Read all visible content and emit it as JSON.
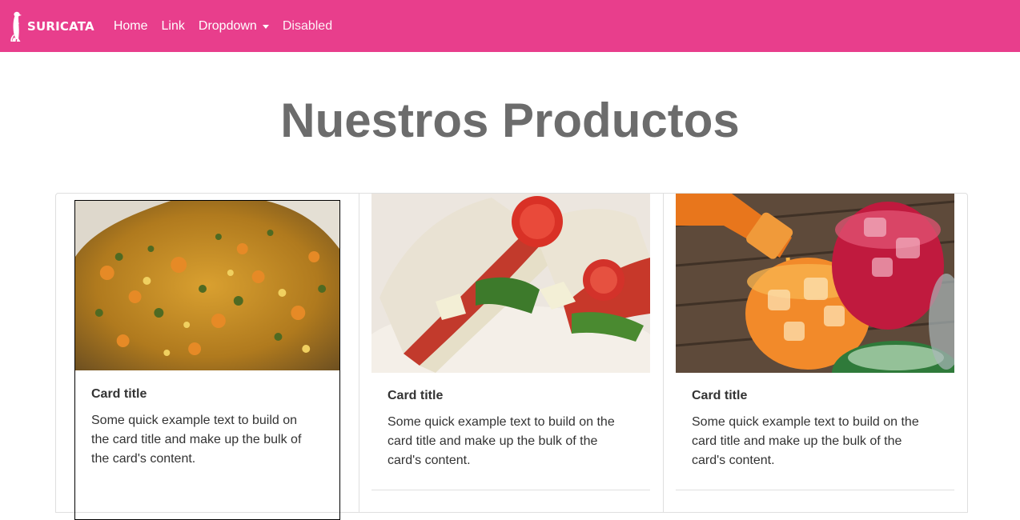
{
  "brand": {
    "name": "SURICATA",
    "icon": "meerkat-icon"
  },
  "nav": {
    "home": "Home",
    "link": "Link",
    "dropdown": "Dropdown",
    "disabled": "Disabled"
  },
  "page": {
    "title": "Nuestros Productos"
  },
  "cards": [
    {
      "image": "vegetable-dish-image",
      "title": "Card title",
      "text": "Some quick example text to build on the card title and make up the bulk of the card's content."
    },
    {
      "image": "sandwich-image",
      "title": "Card title",
      "text": "Some quick example text to build on the card title and make up the bulk of the card's content."
    },
    {
      "image": "drinks-image",
      "title": "Card title",
      "text": "Some quick example text to build on the card title and make up the bulk of the card's content."
    }
  ],
  "colors": {
    "navbar": "#e83e8c",
    "title": "#6c6c6c"
  }
}
